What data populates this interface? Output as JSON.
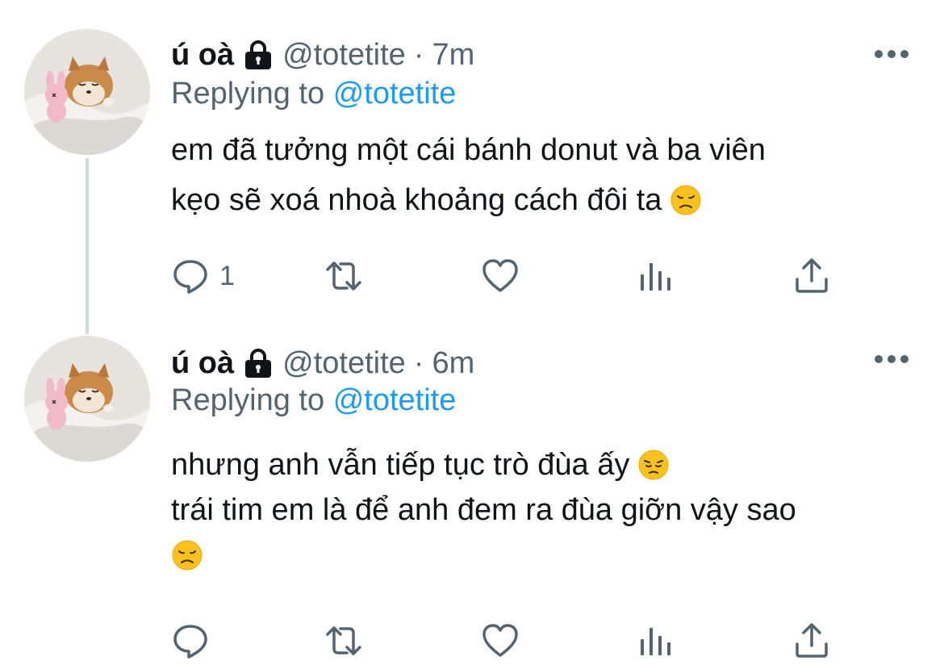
{
  "tweets": [
    {
      "display_name": "ú oà",
      "handle": "@totetite",
      "separator": "·",
      "time": "7m",
      "replying_prefix": "Replying to",
      "replying_mention": "@totetite",
      "lines": [
        "em đã tưởng một cái bánh donut và ba viên",
        "kẹo sẽ xoá nhoà khoảng cách đôi ta"
      ],
      "emojis": [
        "disappointed-face"
      ],
      "reply_count": "1",
      "retweet_count": "",
      "like_count": ""
    },
    {
      "display_name": "ú oà",
      "handle": "@totetite",
      "separator": "·",
      "time": "6m",
      "replying_prefix": "Replying to",
      "replying_mention": "@totetite",
      "lines": [
        "nhưng anh vẫn tiếp tục trò đùa ấy",
        "trái tim em là để anh đem ra đùa giỡn vậy sao"
      ],
      "emojis": [
        "pensive-face",
        "disappointed-face"
      ],
      "reply_count": "",
      "retweet_count": "",
      "like_count": ""
    }
  ],
  "icons": {
    "lock": "lock-icon",
    "more": "more-icon",
    "reply": "reply-icon",
    "retweet": "retweet-icon",
    "like": "heart-icon",
    "analytics": "analytics-icon",
    "share": "share-icon"
  },
  "colors": {
    "text": "#0f1419",
    "secondary": "#536471",
    "link": "#1d9bf0",
    "thread_line": "#cfd9de",
    "emoji": "#fcc21b"
  }
}
